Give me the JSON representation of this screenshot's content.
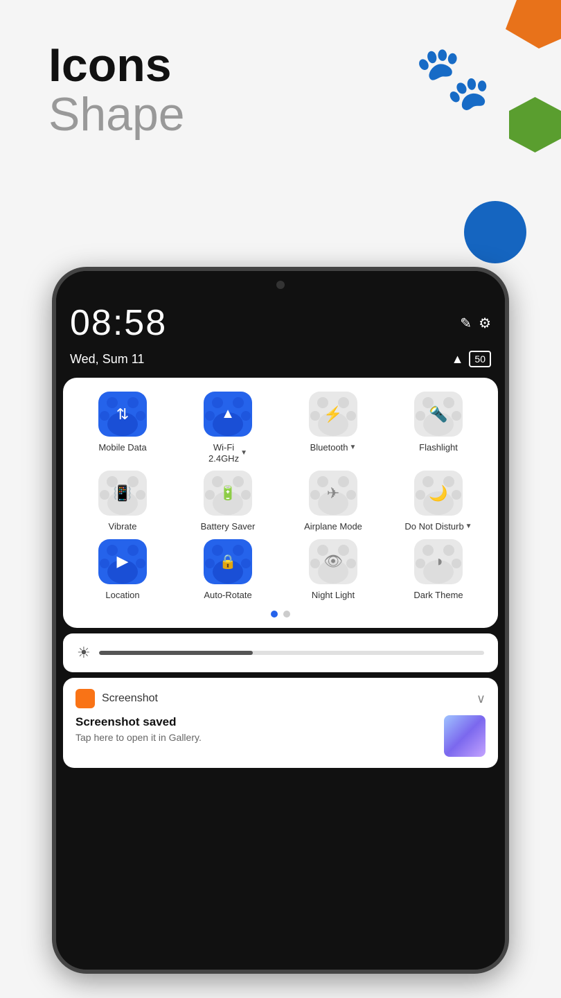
{
  "header": {
    "title": "Icons",
    "subtitle": "Shape"
  },
  "decorative": {
    "logo": "🐾"
  },
  "phone": {
    "time": "08:58",
    "date": "Wed, Sum 11",
    "battery": "50"
  },
  "quickSettings": {
    "items": [
      {
        "id": "mobile-data",
        "label": "Mobile Data",
        "active": true,
        "symbol": "📶",
        "hasArrow": false
      },
      {
        "id": "wifi",
        "label": "Wi-Fi 2.4GHz",
        "active": true,
        "symbol": "wifi",
        "hasArrow": true
      },
      {
        "id": "bluetooth",
        "label": "Bluetooth",
        "active": false,
        "symbol": "bluetooth",
        "hasArrow": true
      },
      {
        "id": "flashlight",
        "label": "Flashlight",
        "active": false,
        "symbol": "flashlight",
        "hasArrow": false
      },
      {
        "id": "vibrate",
        "label": "Vibrate",
        "active": false,
        "symbol": "vibrate",
        "hasArrow": false
      },
      {
        "id": "battery-saver",
        "label": "Battery Saver",
        "active": false,
        "symbol": "battery",
        "hasArrow": false
      },
      {
        "id": "airplane",
        "label": "Airplane Mode",
        "active": false,
        "symbol": "airplane",
        "hasArrow": false
      },
      {
        "id": "dnd",
        "label": "Do Not Disturb",
        "active": false,
        "symbol": "dnd",
        "hasArrow": true
      },
      {
        "id": "location",
        "label": "Location",
        "active": true,
        "symbol": "location",
        "hasArrow": false
      },
      {
        "id": "auto-rotate",
        "label": "Auto-Rotate",
        "active": true,
        "symbol": "rotate",
        "hasArrow": false
      },
      {
        "id": "night-light",
        "label": "Night Light",
        "active": false,
        "symbol": "nightlight",
        "hasArrow": false
      },
      {
        "id": "dark-theme",
        "label": "Dark Theme",
        "active": false,
        "symbol": "darktheme",
        "hasArrow": false
      }
    ],
    "dots": [
      {
        "active": true
      },
      {
        "active": false
      }
    ]
  },
  "brightness": {
    "level": 40
  },
  "notification": {
    "app": "Screenshot",
    "title": "Screenshot saved",
    "subtitle": "Tap here to open it in Gallery.",
    "chevron": "∨"
  }
}
